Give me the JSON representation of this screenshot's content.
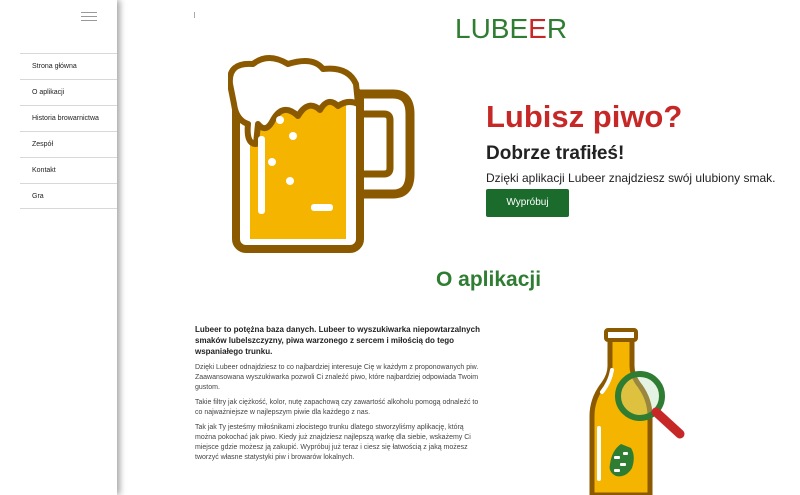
{
  "sidebar": {
    "menu_icon": "hamburger-icon",
    "items": [
      {
        "label": "Strona główna"
      },
      {
        "label": "O aplikacji"
      },
      {
        "label": "Historia browarnictwa"
      },
      {
        "label": "Zespół"
      },
      {
        "label": "Kontakt"
      },
      {
        "label": "Gra"
      }
    ]
  },
  "header": {
    "logo_main": "LUBE",
    "logo_accent": "E",
    "logo_end": "R"
  },
  "hero": {
    "title": "Lubisz piwo?",
    "subtitle": "Dobrze trafiłeś!",
    "text": "Dzięki aplikacji Lubeer znajdziesz swój ulubiony smak.",
    "button": "Wypróbuj",
    "illustration": "beer-mug-icon"
  },
  "about": {
    "title": "O aplikacji",
    "lead": "Lubeer to potężna baza danych. Lubeer to wyszukiwarka niepowtarzalnych smaków lubelszczyzny, piwa warzonego z sercem i miłością do tego wspaniałego trunku.",
    "p1": "Dzięki Lubeer odnajdziesz to co najbardziej interesuje Cię w każdym z proponowanych piw. Zaawansowana wyszukiwarka pozwoli Ci znaleźć piwo, które najbardziej odpowiada Twoim gustom.",
    "p2": "Takie filtry jak ciężkość, kolor, nutę zapachową czy zawartość alkoholu pomogą odnaleźć to co najważniejsze w najlepszym piwie dla każdego z nas.",
    "p3": "Tak jak Ty jesteśmy miłośnikami złocistego trunku dlatego stworzyliśmy aplikację, którą można pokochać jak piwo. Kiedy już znajdziesz najlepszą warkę dla siebie, wskażemy Ci miejsce gdzie możesz ją zakupić. Wypróbuj już teraz i ciesz się łatwością z jaką możesz tworzyć własne statystyki piw i browarów lokalnych.",
    "illustration": "beer-bottle-search-icon"
  },
  "colors": {
    "brand_green": "#2e7d32",
    "button_green": "#1b6b2c",
    "accent_red": "#c62828",
    "beer": "#f5b400",
    "outline": "#8b5a00"
  }
}
